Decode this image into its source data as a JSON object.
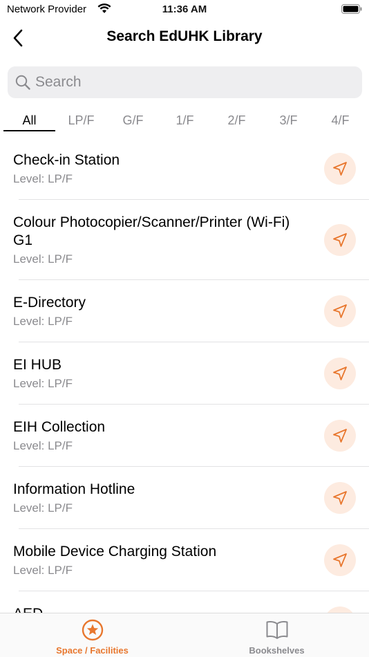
{
  "status_bar": {
    "carrier": "Network Provider",
    "time": "11:36 AM"
  },
  "nav": {
    "title": "Search EdUHK Library",
    "back_icon": "chevron-left-icon"
  },
  "search": {
    "placeholder": "Search",
    "value": ""
  },
  "tabs": [
    {
      "label": "All",
      "active": true
    },
    {
      "label": "LP/F",
      "active": false
    },
    {
      "label": "G/F",
      "active": false
    },
    {
      "label": "1/F",
      "active": false
    },
    {
      "label": "2/F",
      "active": false
    },
    {
      "label": "3/F",
      "active": false
    },
    {
      "label": "4/F",
      "active": false
    }
  ],
  "items": [
    {
      "name": "Check-in Station",
      "level": "Level: LP/F"
    },
    {
      "name": "Colour Photocopier/Scanner/Printer (Wi-Fi) G1",
      "level": "Level: LP/F"
    },
    {
      "name": "E-Directory",
      "level": "Level: LP/F"
    },
    {
      "name": "EI HUB",
      "level": "Level: LP/F"
    },
    {
      "name": "EIH Collection",
      "level": "Level: LP/F"
    },
    {
      "name": "Information Hotline",
      "level": "Level: LP/F"
    },
    {
      "name": "Mobile Device Charging Station",
      "level": "Level: LP/F"
    },
    {
      "name": "AED",
      "level": ""
    }
  ],
  "tab_bar": {
    "items": [
      {
        "label": "Space / Facilities",
        "icon": "star-circle-icon",
        "active": true
      },
      {
        "label": "Bookshelves",
        "icon": "open-book-icon",
        "active": false
      }
    ]
  },
  "colors": {
    "accent": "#e8772e",
    "accent_light": "#fdebe0",
    "inactive": "#8a8a8e"
  }
}
